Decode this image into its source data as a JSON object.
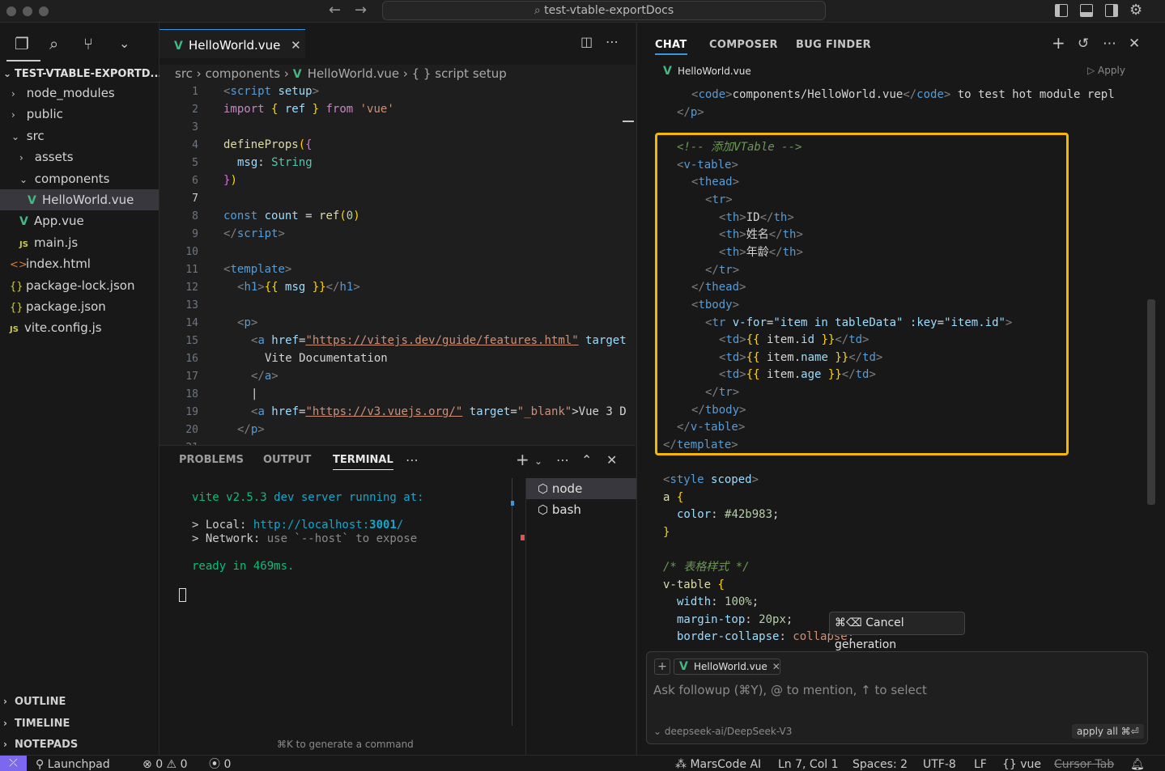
{
  "titlebar": {
    "search_label": "test-vtable-exportDocs",
    "back": "←",
    "forward": "→"
  },
  "sidebar": {
    "explorer_title": "TEST-VTABLE-EXPORTD...",
    "items": [
      {
        "label": "node_modules"
      },
      {
        "label": "public"
      },
      {
        "label": "src"
      },
      {
        "label": "assets"
      },
      {
        "label": "components"
      },
      {
        "label": "HelloWorld.vue"
      },
      {
        "label": "App.vue"
      },
      {
        "label": "main.js"
      },
      {
        "label": "index.html"
      },
      {
        "label": "package-lock.json"
      },
      {
        "label": "package.json"
      },
      {
        "label": "vite.config.js"
      }
    ],
    "sections": [
      "OUTLINE",
      "TIMELINE",
      "NOTEPADS"
    ]
  },
  "editor": {
    "tab_label": "HelloWorld.vue",
    "breadcrumb": [
      "src",
      "components",
      "HelloWorld.vue",
      "{ } script setup"
    ],
    "line_numbers": [
      "1",
      "2",
      "3",
      "4",
      "5",
      "6",
      "7",
      "8",
      "9",
      "10",
      "11",
      "12",
      "13",
      "14",
      "15",
      "16",
      "17",
      "18",
      "19",
      "20",
      "21"
    ],
    "current_line": "7"
  },
  "code": {
    "l1": [
      "<",
      "script",
      " setup",
      ">"
    ],
    "l2": [
      "import",
      " ",
      "{",
      " ref ",
      "}",
      " from ",
      "'vue'"
    ],
    "l4": [
      "defineProps",
      "(",
      "{"
    ],
    "l5": [
      "msg",
      ": ",
      "String"
    ],
    "l6": [
      "}",
      ")"
    ],
    "l8": [
      "const",
      " count ",
      "=",
      " ref",
      "(",
      "0",
      ")"
    ],
    "l9": [
      "</",
      "script",
      ">"
    ],
    "l11": [
      "<",
      "template",
      ">"
    ],
    "l12": [
      "<",
      "h1",
      ">",
      "{{",
      " msg ",
      "}}",
      "</",
      "h1",
      ">"
    ],
    "l14": [
      "<",
      "p",
      ">"
    ],
    "l15": [
      "<",
      "a",
      " href",
      "=",
      "\"https://vitejs.dev/guide/features.html\"",
      " target"
    ],
    "l16": "Vite Documentation",
    "l17": [
      "</",
      "a",
      ">"
    ],
    "l18": "|",
    "l19": [
      "<",
      "a",
      " href",
      "=",
      "\"https://v3.vuejs.org/\"",
      " target",
      "=",
      "\"_blank\"",
      ">Vue 3 D"
    ],
    "l20": [
      "</",
      "p",
      ">"
    ]
  },
  "panel": {
    "tabs": [
      "PROBLEMS",
      "OUTPUT",
      "TERMINAL"
    ],
    "active_tab": "TERMINAL",
    "terminal": {
      "line1_a": "vite v2.5.3",
      "line1_b": " dev server running at:",
      "local_label": "> Local: ",
      "local_url_a": "http://localhost:",
      "local_url_b": "3001",
      "local_url_c": "/",
      "network_label": "> Network: ",
      "network_text": "use `--host` to expose",
      "ready_a": "ready in ",
      "ready_b": "469ms."
    },
    "terminal_list": [
      "node",
      "bash"
    ],
    "hint": "⌘K to generate a command"
  },
  "chat": {
    "tabs": [
      "CHAT",
      "COMPOSER",
      "BUG FINDER"
    ],
    "file_label": "HelloWorld.vue",
    "apply_label": "Apply",
    "code_pre1": {
      "open": "<",
      "tag": "code",
      "close": ">",
      "text": "components/HelloWorld.vue",
      "end_open": "</",
      "end_tag": "code",
      "end_close": ">",
      "rest": " to test hot module repl"
    },
    "code_pre2": [
      "</",
      "p",
      ">"
    ],
    "highlight_lines": {
      "comment": "<!-- 添加VTable -->",
      "vtable_open": [
        "<",
        "v-table",
        ">"
      ],
      "thead_open": [
        "<",
        "thead",
        ">"
      ],
      "tr_open": [
        "<",
        "tr",
        ">"
      ],
      "th1": [
        "<",
        "th",
        ">",
        "ID",
        "</",
        "th",
        ">"
      ],
      "th2": [
        "<",
        "th",
        ">",
        "姓名",
        "</",
        "th",
        ">"
      ],
      "th3": [
        "<",
        "th",
        ">",
        "年龄",
        "</",
        "th",
        ">"
      ],
      "tr_close": [
        "</",
        "tr",
        ">"
      ],
      "thead_close": [
        "</",
        "thead",
        ">"
      ],
      "tbody_open": [
        "<",
        "tbody",
        ">"
      ],
      "tr_for": [
        "<",
        "tr",
        " v-for",
        "=",
        "\"item in tableData\"",
        " :key",
        "=",
        "\"item.id\"",
        ">"
      ],
      "td1": [
        "<",
        "td",
        ">",
        "{{",
        " item.",
        "id",
        " ",
        "}}",
        "</",
        "td",
        ">"
      ],
      "td2": [
        "<",
        "td",
        ">",
        "{{",
        " item.",
        "name",
        " ",
        "}}",
        "</",
        "td",
        ">"
      ],
      "td3": [
        "<",
        "td",
        ">",
        "{{",
        " item.",
        "age",
        " ",
        "}}",
        "</",
        "td",
        ">"
      ],
      "tr_close2": [
        "</",
        "tr",
        ">"
      ],
      "tbody_close": [
        "</",
        "tbody",
        ">"
      ],
      "vtable_close": [
        "</",
        "v-table",
        ">"
      ],
      "template_close": [
        "</",
        "template",
        ">"
      ]
    },
    "style_lines": {
      "style_open": [
        "<",
        "style",
        " scoped",
        ">"
      ],
      "a_sel": [
        "a",
        " {"
      ],
      "color": [
        "color",
        ": ",
        "#42b983",
        ";"
      ],
      "brace": "}",
      "comment": "/* 表格样式 */",
      "vt_sel": [
        "v-table",
        " {"
      ],
      "width": [
        "width",
        ": ",
        "100%",
        ";"
      ],
      "margin": [
        "margin-top",
        ": ",
        "20px",
        ";"
      ],
      "border": [
        "border-collapse",
        ": ",
        "collapse",
        ";"
      ]
    },
    "cancel_tip": "⌘⌫ Cancel generation",
    "compose": {
      "chip": "HelloWorld.vue",
      "placeholder": "Ask followup (⌘Y), @ to mention, ↑ to select",
      "model": "deepseek-ai/DeepSeek-V3",
      "apply_all": "apply all ⌘⏎"
    }
  },
  "statusbar": {
    "launchpad": "Launchpad",
    "errors": "0",
    "warnings": "0",
    "ports": "0",
    "marscode": "MarsCode AI",
    "position": "Ln 7, Col 1",
    "spaces": "Spaces: 2",
    "encoding": "UTF-8",
    "eol": "LF",
    "language": "vue",
    "cursor_tab": "Cursor Tab"
  },
  "colors": {
    "accent": "#3a96dd",
    "highlight_border": "#f5b700",
    "vue_green": "#42b883",
    "remote_bg": "#7b68ee"
  }
}
